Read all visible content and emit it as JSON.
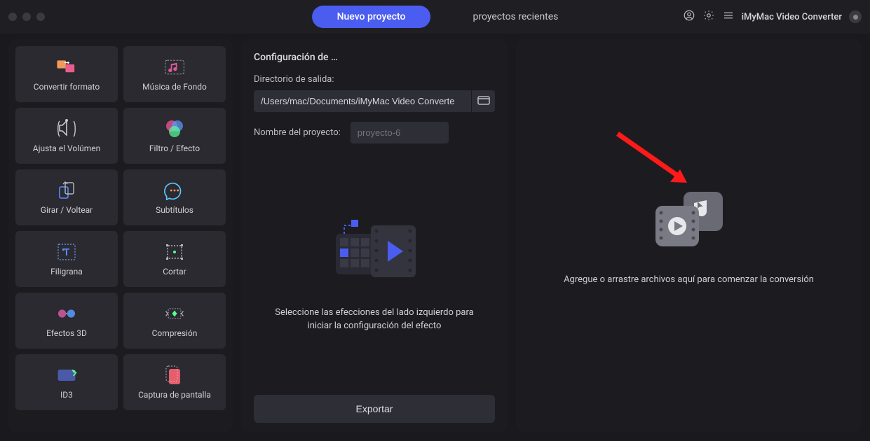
{
  "titlebar": {
    "tab_new": "Nuevo proyecto",
    "tab_recent": "proyectos recientes",
    "app_name": "iMyMac Video Converter"
  },
  "sidebar": {
    "items": [
      {
        "key": "convert-format",
        "label": "Convertir formato"
      },
      {
        "key": "bg-music",
        "label": "Música de Fondo"
      },
      {
        "key": "adjust-volume",
        "label": "Ajusta el Volúmen"
      },
      {
        "key": "filter-effect",
        "label": "Filtro / Efecto"
      },
      {
        "key": "rotate-flip",
        "label": "Girar / Voltear"
      },
      {
        "key": "subtitles",
        "label": "Subtítulos"
      },
      {
        "key": "watermark",
        "label": "Filigrana"
      },
      {
        "key": "crop",
        "label": "Cortar"
      },
      {
        "key": "3d-effects",
        "label": "Efectos 3D"
      },
      {
        "key": "compression",
        "label": "Compresión"
      },
      {
        "key": "id3",
        "label": "ID3"
      },
      {
        "key": "screenshot",
        "label": "Captura de pantalla"
      }
    ]
  },
  "config": {
    "heading": "Configuración de …",
    "output_dir_label": "Directorio de salida:",
    "output_dir_value": "/Users/mac/Documents/iMyMac Video Converte",
    "project_name_label": "Nombre del proyecto:",
    "project_name_placeholder": "proyecto-6",
    "hero_text": "Seleccione las efecciones del lado izquierdo para iniciar la configuración del efecto",
    "export_label": "Exportar"
  },
  "dropzone": {
    "text": "Agregue o arrastre archivos aquí para comenzar la conversión"
  }
}
